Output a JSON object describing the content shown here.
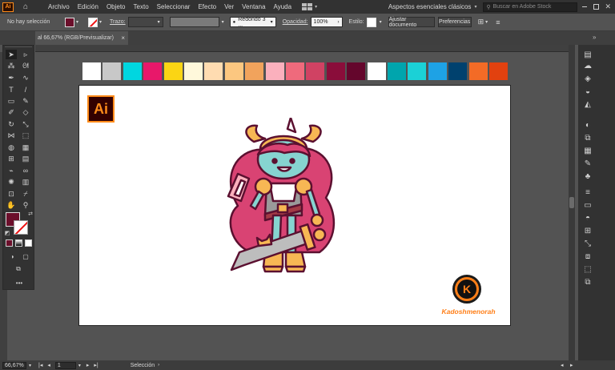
{
  "app": {
    "logo": "Ai",
    "menu": [
      "Archivo",
      "Edición",
      "Objeto",
      "Texto",
      "Seleccionar",
      "Efecto",
      "Ver",
      "Ventana",
      "Ayuda"
    ],
    "workspace": "Aspectos esenciales clásicos",
    "stock_search_placeholder": "Buscar en Adobe Stock"
  },
  "control_bar": {
    "selection_label": "No hay selección",
    "stroke_label": "Trazo:",
    "brush_value": "Redondo 3 ...",
    "opacity_label": "Opacidad:",
    "opacity_value": "100%",
    "style_label": "Estilo:",
    "adjust_document_label": "Ajustar documento",
    "preferences_label": "Preferencias"
  },
  "document_tab": {
    "title": "al 66,67% (RGB/Previsualizar)",
    "close": "×"
  },
  "status_bar": {
    "zoom": "66,67%",
    "artboard_number": "1",
    "tool_name": "Selección"
  },
  "artboard": {
    "badge_text": "Ai",
    "watermark_letter": "K",
    "watermark_text": "Kadoshmenorah"
  },
  "swatches": [
    "#ffffff",
    "#c8c8c8",
    "#00d6e0",
    "#e8186a",
    "#fbd514",
    "#fff8db",
    "#ffdcb1",
    "#fcc780",
    "#f1a35c",
    "#fbb0bd",
    "#ef6a7c",
    "#d04263",
    "#8a0d3a",
    "#64062c",
    "#ffffff",
    "#00a5ad",
    "#1bd1d6",
    "#1ea2e5",
    "#00416e",
    "#f36b26",
    "#e2410f"
  ],
  "colors": {
    "fill": "#6b0f2b",
    "accent_orange": "#ff7f18",
    "skin": "#86d4d0",
    "hair": "#d94373",
    "gold": "#f7b754"
  }
}
